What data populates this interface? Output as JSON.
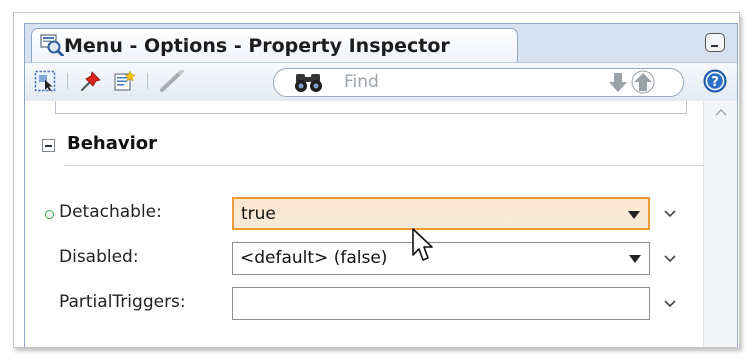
{
  "window": {
    "title": "Menu - Options - Property Inspector",
    "icons": {
      "tab": "property-inspector-icon",
      "minimize": "minimize-icon"
    }
  },
  "toolbar": {
    "icons": [
      "select-component-icon",
      "pin-icon",
      "edit-properties-icon",
      "pencil-icon",
      "binoculars-icon",
      "arrow-down-icon",
      "arrow-up-icon",
      "help-icon"
    ],
    "search_placeholder": "Find"
  },
  "section": {
    "title": "Behavior",
    "expanded": true
  },
  "properties": [
    {
      "label": "Detachable:",
      "value": "true",
      "type": "dropdown",
      "has_value_indicator": true,
      "highlighted": true
    },
    {
      "label": "Disabled:",
      "value": "<default> (false)",
      "type": "dropdown",
      "has_value_indicator": false,
      "highlighted": false
    },
    {
      "label": "PartialTriggers:",
      "value": "",
      "type": "text",
      "has_value_indicator": false,
      "highlighted": false
    }
  ],
  "colors": {
    "accent_orange": "#f09a3a",
    "panel_blue": "#d7e2f0",
    "value_indicator": "#3aa547",
    "help_blue": "#2b6fc6"
  }
}
